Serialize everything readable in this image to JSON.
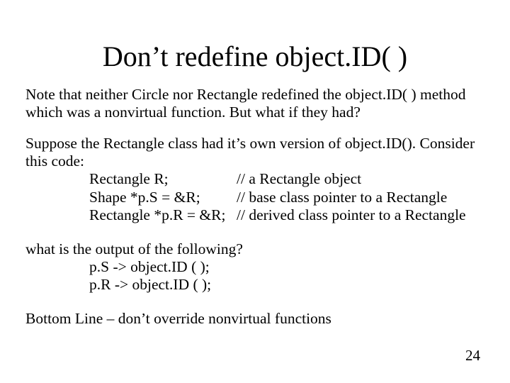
{
  "title": "Don’t redefine object.ID( )",
  "para1": "Note that neither Circle nor Rectangle redefined the object.ID( ) method which was a nonvirtual function.  But what if they had?",
  "para2_lead": "Suppose the Rectangle class had it’s own version of object.ID(). Consider this code:",
  "code": {
    "r1l": "Rectangle R;",
    "r1r": "// a Rectangle object",
    "r2l": "Shape *p.S = &R;",
    "r2r": "// base class pointer to a Rectangle",
    "r3l": "Rectangle *p.R = &R;",
    "r3r": "// derived class pointer to a Rectangle"
  },
  "question": {
    "lead": "what is the output of the following?",
    "l1": "p.S  -> object.ID ( );",
    "l2": "p.R -> object.ID ( );"
  },
  "bottom_line": "Bottom Line – don’t override nonvirtual functions",
  "page_number": "24"
}
